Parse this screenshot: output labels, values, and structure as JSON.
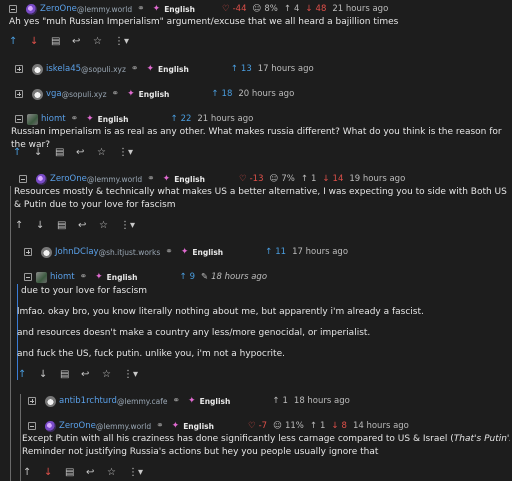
{
  "c1": {
    "user": "ZeroOne",
    "instance": "@lemmy.world",
    "lang": "English",
    "score": "-44",
    "pct": "8%",
    "up": "4",
    "down": "48",
    "time": "21 hours ago",
    "text": "Ah yes \"muh Russian Imperialism\" argument/excuse that we all heard a bajillion times"
  },
  "c2": {
    "user": "iskela45",
    "instance": "@sopuli.xyz",
    "lang": "English",
    "score": "13",
    "time": "17 hours ago"
  },
  "c3": {
    "user": "vga",
    "instance": "@sopuli.xyz",
    "lang": "English",
    "score": "18",
    "time": "20 hours ago"
  },
  "c4": {
    "user": "hiomt",
    "lang": "English",
    "score": "22",
    "time": "21 hours ago",
    "text": "Russian imperialism is as real as any other. What makes russia different? What do you think is the reason for the war?"
  },
  "c5": {
    "user": "ZeroOne",
    "instance": "@lemmy.world",
    "lang": "English",
    "score": "-13",
    "pct": "7%",
    "up": "1",
    "down": "14",
    "time": "19 hours ago",
    "text": "Resources mostly & technically what makes US a better alternative, I was expecting you to side with Both US & Putin due to your love for fascism"
  },
  "c6": {
    "user": "JohnDClay",
    "instance": "@sh.itjust.works",
    "lang": "English",
    "score": "11",
    "time": "17 hours ago"
  },
  "c7": {
    "user": "hiomt",
    "lang": "English",
    "score": "9",
    "time": "18 hours ago",
    "quote": "due to your love for fascism",
    "p1": "lmfao. okay bro, you know literally nothing about me, but apparently i'm already a fascist.",
    "p2": "and resources doesn't make a country any less/more genocidal, or imperialist.",
    "p3": "and fuck the US, fuck putin. unlike you, i'm not a hypocrite."
  },
  "c8": {
    "user": "antib1rchturd",
    "instance": "@lemmy.cafe",
    "lang": "English",
    "score": "1",
    "time": "18 hours ago"
  },
  "c9": {
    "user": "ZeroOne",
    "instance": "@lemmy.world",
    "lang": "English",
    "score": "-7",
    "pct": "11%",
    "up": "1",
    "down": "8",
    "time": "14 hours ago",
    "text_a": "Except Putin with all his craziness has done significantly less carnage compared to US & Israel (",
    "text_em": "That's Putin's only redeeming quality",
    "text_b": ")",
    "text2": "Reminder not justifying Russia's actions but hey you people usually ignore that"
  }
}
